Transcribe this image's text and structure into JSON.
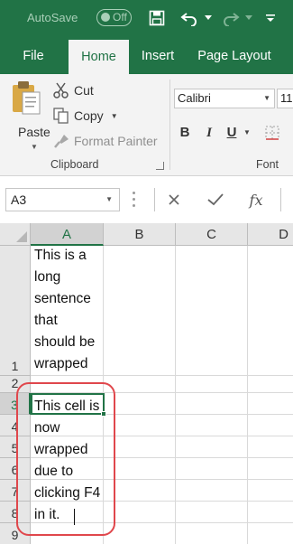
{
  "titlebar": {
    "autosave_label": "AutoSave",
    "autosave_state": "Off",
    "icons": [
      "save-icon",
      "undo-icon",
      "redo-icon",
      "customize-quick-access-icon"
    ],
    "accent_color": "#217346"
  },
  "tabs": [
    {
      "label": "File"
    },
    {
      "label": "Home",
      "active": true
    },
    {
      "label": "Insert"
    },
    {
      "label": "Page Layout"
    }
  ],
  "ribbon": {
    "clipboard": {
      "paste_label": "Paste",
      "cut_label": "Cut",
      "copy_label": "Copy",
      "format_painter_label": "Format Painter",
      "group_label": "Clipboard"
    },
    "font": {
      "font_name": "Calibri",
      "font_size": "11",
      "bold_label": "B",
      "italic_label": "I",
      "underline_label": "U",
      "group_label": "Font"
    }
  },
  "formula_bar": {
    "name_box_value": "A3",
    "fx_label": "fx",
    "icons": [
      "cancel-icon",
      "enter-icon",
      "insert-function-icon"
    ]
  },
  "grid": {
    "columns": [
      "A",
      "B",
      "C",
      "D"
    ],
    "selected_column": "A",
    "rows": [
      "1",
      "2",
      "3",
      "4",
      "5",
      "6",
      "7",
      "8",
      "9"
    ],
    "selected_row": "3",
    "active_cell": "A3",
    "cells": {
      "A1": "This is a\nlong\nsentence\nthat\nshould be\nwrapped",
      "A3": "This cell is\nnow\nwrapped\ndue to\nclicking F4\nin it."
    },
    "annotation_color": "#e0474c"
  }
}
